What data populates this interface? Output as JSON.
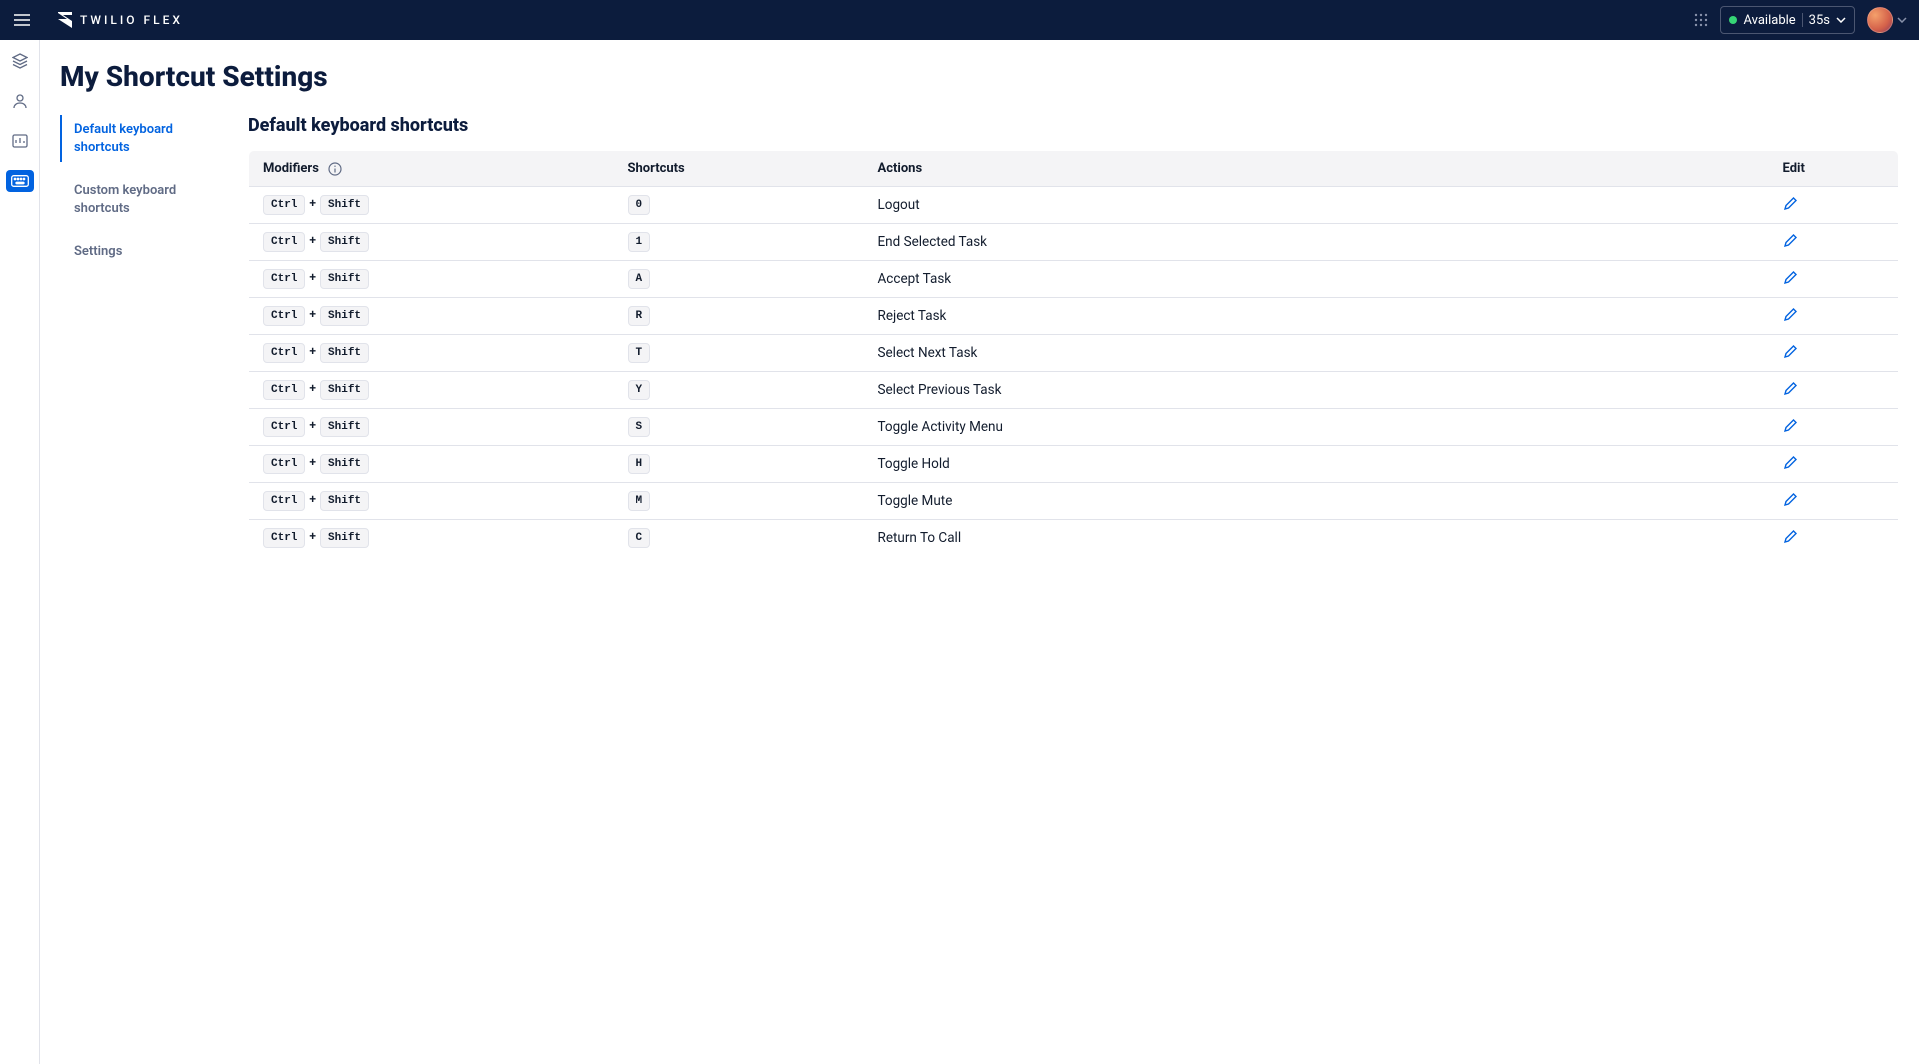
{
  "header": {
    "brand": "TWILIO FLEX",
    "status_label": "Available",
    "status_duration": "35s"
  },
  "page": {
    "title": "My Shortcut Settings",
    "section_title": "Default keyboard shortcuts"
  },
  "side_nav": {
    "items": [
      {
        "label": "Default keyboard shortcuts",
        "active": true
      },
      {
        "label": "Custom keyboard shortcuts",
        "active": false
      },
      {
        "label": "Settings",
        "active": false
      }
    ]
  },
  "table": {
    "headers": {
      "modifiers": "Modifiers",
      "shortcuts": "Shortcuts",
      "actions": "Actions",
      "edit": "Edit"
    },
    "modifier_keys": {
      "ctrl": "Ctrl",
      "shift": "Shift",
      "plus": "+"
    },
    "rows": [
      {
        "key": "0",
        "action": "Logout"
      },
      {
        "key": "1",
        "action": "End Selected Task"
      },
      {
        "key": "A",
        "action": "Accept Task"
      },
      {
        "key": "R",
        "action": "Reject Task"
      },
      {
        "key": "T",
        "action": "Select Next Task"
      },
      {
        "key": "Y",
        "action": "Select Previous Task"
      },
      {
        "key": "S",
        "action": "Toggle Activity Menu"
      },
      {
        "key": "H",
        "action": "Toggle Hold"
      },
      {
        "key": "M",
        "action": "Toggle Mute"
      },
      {
        "key": "C",
        "action": "Return To Call"
      }
    ]
  }
}
